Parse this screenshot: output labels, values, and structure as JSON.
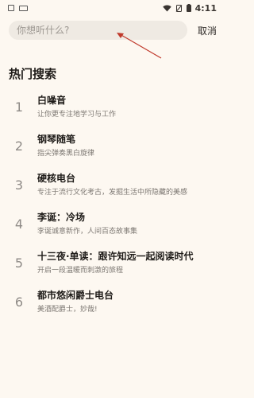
{
  "status_bar": {
    "time": "4:11"
  },
  "search": {
    "placeholder": "你想听什么?",
    "value": "",
    "cancel_label": "取消"
  },
  "hot_section": {
    "title": "热门搜索",
    "items": [
      {
        "rank": "1",
        "title": "白噪音",
        "desc": "让你更专注地学习与工作"
      },
      {
        "rank": "2",
        "title": "钢琴随笔",
        "desc": "指尖弹奏黑白旋律"
      },
      {
        "rank": "3",
        "title": "硬核电台",
        "desc": "专注于流行文化考古，发掘生活中所隐藏的美感"
      },
      {
        "rank": "4",
        "title": "李诞：冷场",
        "desc": "李诞诚意新作，人间百态故事集"
      },
      {
        "rank": "5",
        "title": "十三夜·单读：跟许知远一起阅读时代",
        "desc": "开启一段温暖而刺激的旅程"
      },
      {
        "rank": "6",
        "title": "都市悠闲爵士电台",
        "desc": "美酒配爵士，妙哉!"
      }
    ]
  },
  "colors": {
    "background": "#fdf8f1",
    "search_bg": "#efeae3",
    "annotation_arrow": "#c0392b"
  }
}
